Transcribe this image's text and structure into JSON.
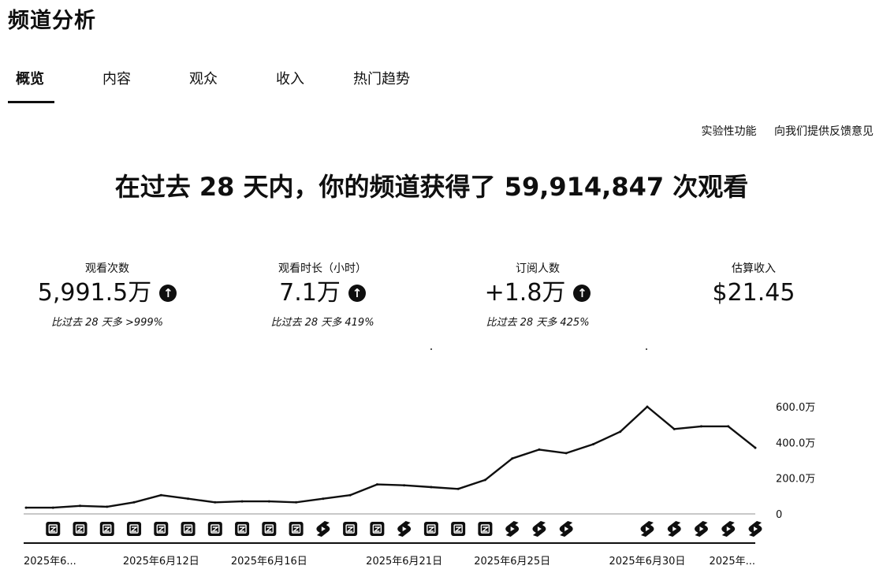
{
  "page": {
    "title": "频道分析"
  },
  "tabs": [
    {
      "label": "概览",
      "active": true
    },
    {
      "label": "内容",
      "active": false
    },
    {
      "label": "观众",
      "active": false
    },
    {
      "label": "收入",
      "active": false
    },
    {
      "label": "热门趋势",
      "active": false
    }
  ],
  "links": {
    "experimental": "实验性功能",
    "feedback": "向我们提供反馈意见"
  },
  "headline": "在过去 28 天内，你的频道获得了 59,914,847 次观看",
  "metrics": [
    {
      "label": "观看次数",
      "value": "5,991.5万",
      "compare": "比过去 28 天多 >999%",
      "trend": "up"
    },
    {
      "label": "观看时长（小时）",
      "value": "7.1万",
      "compare": "比过去 28 天多 419%",
      "trend": "up"
    },
    {
      "label": "订阅人数",
      "value": "+1.8万",
      "compare": "比过去 28 天多 425%",
      "trend": "up"
    },
    {
      "label": "估算收入",
      "value": "$21.45",
      "compare": "",
      "trend": ""
    }
  ],
  "chart_data": {
    "type": "line",
    "y_unit": "万",
    "ylim": [
      0,
      600
    ],
    "y_ticks": [
      "600.0万",
      "400.0万",
      "200.0万",
      "0"
    ],
    "y_tick_values": [
      600,
      400,
      200,
      0
    ],
    "grid": false,
    "x": [
      "2025-06-07",
      "2025-06-08",
      "2025-06-09",
      "2025-06-10",
      "2025-06-11",
      "2025-06-12",
      "2025-06-13",
      "2025-06-14",
      "2025-06-15",
      "2025-06-16",
      "2025-06-17",
      "2025-06-18",
      "2025-06-19",
      "2025-06-20",
      "2025-06-21",
      "2025-06-22",
      "2025-06-23",
      "2025-06-24",
      "2025-06-25",
      "2025-06-26",
      "2025-06-27",
      "2025-06-28",
      "2025-06-29",
      "2025-06-30",
      "2025-07-01",
      "2025-07-02",
      "2025-07-03",
      "2025-07-04"
    ],
    "values": [
      35,
      35,
      45,
      40,
      65,
      105,
      85,
      65,
      70,
      70,
      65,
      85,
      105,
      165,
      160,
      150,
      140,
      190,
      310,
      360,
      340,
      390,
      460,
      600,
      475,
      490,
      490,
      370
    ],
    "x_tick_labels": [
      {
        "index": 0,
        "label": "2025年6..."
      },
      {
        "index": 5,
        "label": "2025年6月12日"
      },
      {
        "index": 9,
        "label": "2025年6月16日"
      },
      {
        "index": 14,
        "label": "2025年6月21日"
      },
      {
        "index": 18,
        "label": "2025年6月25日"
      },
      {
        "index": 23,
        "label": "2025年6月30日"
      },
      {
        "index": 27,
        "label": "2025年..."
      }
    ],
    "markers": [
      {
        "index": 1,
        "icon": "video-icon"
      },
      {
        "index": 2,
        "icon": "video-icon"
      },
      {
        "index": 3,
        "icon": "video-icon"
      },
      {
        "index": 4,
        "icon": "video-icon"
      },
      {
        "index": 5,
        "icon": "video-icon"
      },
      {
        "index": 6,
        "icon": "video-icon"
      },
      {
        "index": 7,
        "icon": "video-icon"
      },
      {
        "index": 8,
        "icon": "video-icon"
      },
      {
        "index": 9,
        "icon": "video-icon"
      },
      {
        "index": 10,
        "icon": "video-icon"
      },
      {
        "index": 11,
        "icon": "shorts-icon"
      },
      {
        "index": 12,
        "icon": "video-icon"
      },
      {
        "index": 13,
        "icon": "video-icon"
      },
      {
        "index": 14,
        "icon": "shorts-icon"
      },
      {
        "index": 15,
        "icon": "video-icon"
      },
      {
        "index": 16,
        "icon": "video-icon"
      },
      {
        "index": 17,
        "icon": "video-icon"
      },
      {
        "index": 18,
        "icon": "shorts-icon"
      },
      {
        "index": 19,
        "icon": "shorts-icon"
      },
      {
        "index": 20,
        "icon": "shorts-icon"
      },
      {
        "index": 23,
        "icon": "shorts-icon"
      },
      {
        "index": 24,
        "icon": "shorts-icon"
      },
      {
        "index": 25,
        "icon": "shorts-icon"
      },
      {
        "index": 26,
        "icon": "shorts-icon"
      },
      {
        "index": 27,
        "icon": "shorts-icon"
      }
    ]
  }
}
